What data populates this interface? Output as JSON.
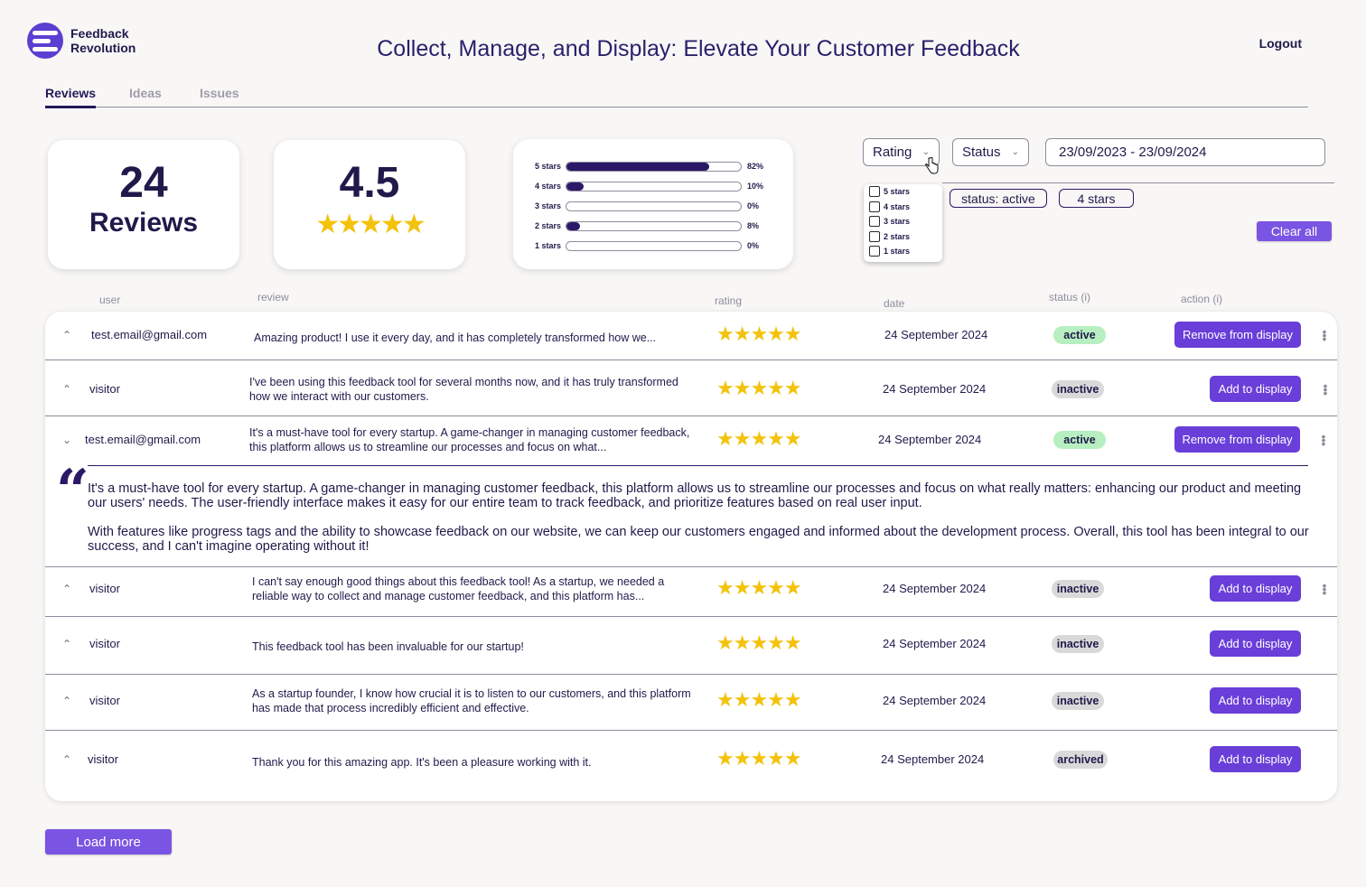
{
  "brand": {
    "name_line1": "Feedback",
    "name_line2": "Revolution"
  },
  "header": {
    "title": "Collect, Manage, and Display: Elevate Your Customer Feedback",
    "logout": "Logout"
  },
  "tabs": [
    {
      "label": "Reviews",
      "active": true
    },
    {
      "label": "Ideas",
      "active": false
    },
    {
      "label": "Issues",
      "active": false
    }
  ],
  "stats": {
    "review_count": "24",
    "review_label": "Reviews",
    "average": "4.5",
    "average_stars": "★★★★★"
  },
  "distribution": [
    {
      "label": "5 stars",
      "fraction": 0.82,
      "pct": "82%"
    },
    {
      "label": "4 stars",
      "fraction": 0.1,
      "pct": "10%"
    },
    {
      "label": "3 stars",
      "fraction": 0.0,
      "pct": "0%"
    },
    {
      "label": "2 stars",
      "fraction": 0.08,
      "pct": "8%"
    },
    {
      "label": "1 stars",
      "fraction": 0.0,
      "pct": "0%"
    }
  ],
  "filters": {
    "rating_label": "Rating",
    "status_label": "Status",
    "date_range": "23/09/2023 - 23/09/2024",
    "rating_options": [
      "5 stars",
      "4 stars",
      "3 stars",
      "2 stars",
      "1 stars"
    ],
    "chips": [
      "status: active",
      "4 stars"
    ],
    "clear_all": "Clear all"
  },
  "columns": {
    "user": "user",
    "review": "review",
    "rating": "rating",
    "date": "date",
    "status": "status (i)",
    "action": "action (i)"
  },
  "rows": [
    {
      "user": "test.email@gmail.com",
      "review": "Amazing product! I use it every day, and it has completely transformed how we...",
      "stars": "★★★★★",
      "date": "24 September 2024",
      "status": "active",
      "action": "Remove from display"
    },
    {
      "user": "visitor",
      "review": "I've been using this feedback tool for several months now, and it has truly transformed how we interact with our customers.",
      "stars": "★★★★★",
      "date": "24 September 2024",
      "status": "inactive",
      "action": "Add to display"
    },
    {
      "user": "test.email@gmail.com",
      "review": "It's a must-have tool for every startup. A game-changer in managing customer feedback, this platform allows us to streamline our processes and focus on what...",
      "stars": "★★★★★",
      "date": "24 September 2024",
      "status": "active",
      "action": "Remove from display"
    },
    {
      "user": "visitor",
      "review": "I can't say enough good things about this feedback tool! As a startup, we needed a reliable way to collect and manage customer feedback, and this platform has...",
      "stars": "★★★★★",
      "date": "24 September 2024",
      "status": "inactive",
      "action": "Add to display"
    },
    {
      "user": "visitor",
      "review": "This feedback tool has been invaluable for our startup!",
      "stars": "★★★★★",
      "date": "24 September 2024",
      "status": "inactive",
      "action": "Add to display"
    },
    {
      "user": "visitor",
      "review": "As a startup founder, I know how crucial it is to listen to our customers, and this platform has made that process incredibly efficient and effective.",
      "stars": "★★★★★",
      "date": "24 September 2024",
      "status": "inactive",
      "action": "Add to display"
    },
    {
      "user": "visitor",
      "review": "Thank you for this amazing app. It's been a pleasure working with it.",
      "stars": "★★★★★",
      "date": "24 September 2024",
      "status": "archived",
      "action": "Add to display"
    }
  ],
  "expanded": {
    "paragraph1": "It's a must-have tool for every startup. A game-changer in managing customer feedback, this platform allows us to streamline our processes and focus on what really matters: enhancing our product and meeting our users' needs. The user-friendly interface makes it easy for our entire team to track feedback, and prioritize features based on real user input.",
    "paragraph2": "With features like progress tags and the ability to showcase feedback on our website, we can keep our customers engaged and informed about the development process. Overall, this tool has been integral to our success, and I can't imagine operating without it!"
  },
  "load_more": "Load more",
  "colors": {
    "accent": "#6a3ed8",
    "brand_dark": "#2b1968",
    "star": "#f3c20c",
    "active_badge": "#b7efc0",
    "inactive_badge": "#d9d9d9"
  }
}
